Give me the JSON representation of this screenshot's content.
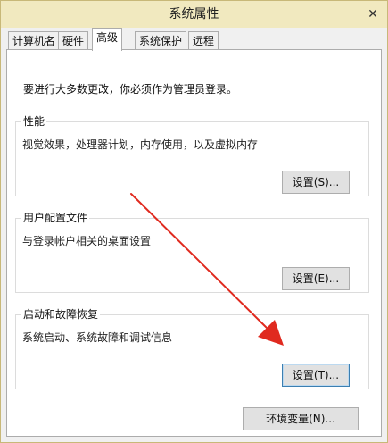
{
  "window": {
    "title": "系统属性",
    "close_glyph": "✕"
  },
  "tabs": [
    {
      "label": "计算机名"
    },
    {
      "label": "硬件"
    },
    {
      "label": "高级",
      "selected": true
    },
    {
      "label": "系统保护"
    },
    {
      "label": "远程"
    }
  ],
  "admin_note": "要进行大多数更改，你必须作为管理员登录。",
  "groups": {
    "performance": {
      "title": "性能",
      "description": "视觉效果，处理器计划，内存使用，以及虚拟内存",
      "button": "设置(S)..."
    },
    "user_profiles": {
      "title": "用户配置文件",
      "description": "与登录帐户相关的桌面设置",
      "button": "设置(E)..."
    },
    "startup_recovery": {
      "title": "启动和故障恢复",
      "description": "系统启动、系统故障和调试信息",
      "button": "设置(T)..."
    }
  },
  "env_button": "环境变量(N)...",
  "colors": {
    "arrow": "#e02a1f",
    "focus_border": "#3c7fb1",
    "title_bar": "#f1e9bf"
  },
  "icons": [
    "close-icon",
    "red-arrow-annotation"
  ]
}
